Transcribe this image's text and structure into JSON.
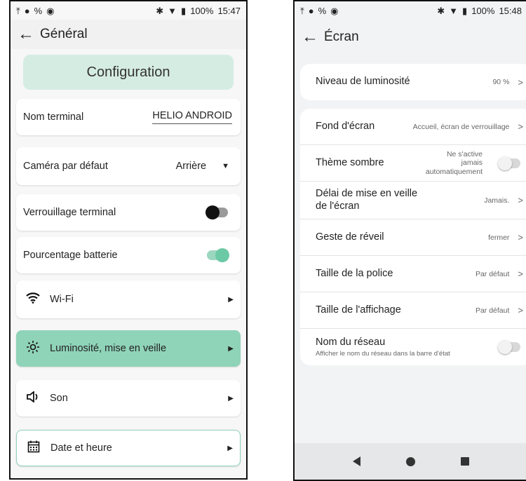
{
  "left": {
    "status": {
      "battery": "100%",
      "time": "15:47"
    },
    "title": "Général",
    "banner": "Configuration",
    "nom_terminal": {
      "label": "Nom terminal",
      "value": "HELIO ANDROID"
    },
    "camera": {
      "label": "Caméra par défaut",
      "value": "Arrière"
    },
    "verrouillage": {
      "label": "Verrouillage terminal",
      "state": "off"
    },
    "batterie": {
      "label": "Pourcentage batterie",
      "state": "on"
    },
    "menu": [
      {
        "label": "Wi-Fi",
        "icon": "wifi-icon"
      },
      {
        "label": "Luminosité, mise en veille",
        "icon": "brightness-icon",
        "selected": true
      },
      {
        "label": "Son",
        "icon": "speaker-icon"
      },
      {
        "label": "Date et heure",
        "icon": "calendar-icon"
      }
    ],
    "accent_color": "#8fd3b8"
  },
  "right": {
    "status": {
      "battery": "100%",
      "time": "15:48"
    },
    "title": "Écran",
    "luminosite": {
      "label": "Niveau de luminosité",
      "value": "90 %"
    },
    "fond": {
      "label": "Fond d'écran",
      "value": "Accueil, écran de verrouillage"
    },
    "theme": {
      "label": "Thème sombre",
      "value_l1": "Ne s'active",
      "value_l2": "jamais",
      "value_l3": "automatiquement"
    },
    "delai": {
      "label_l1": "Délai de mise en veille",
      "label_l2": "de l'écran",
      "value": "Jamais."
    },
    "geste": {
      "label": "Geste de réveil",
      "value": "fermer"
    },
    "police": {
      "label": "Taille de la police",
      "value": "Par défaut"
    },
    "affichage": {
      "label": "Taille de l'affichage",
      "value": "Par défaut"
    },
    "reseau": {
      "label": "Nom du réseau",
      "sub": "Afficher le nom du réseau dans la barre d'état"
    }
  }
}
